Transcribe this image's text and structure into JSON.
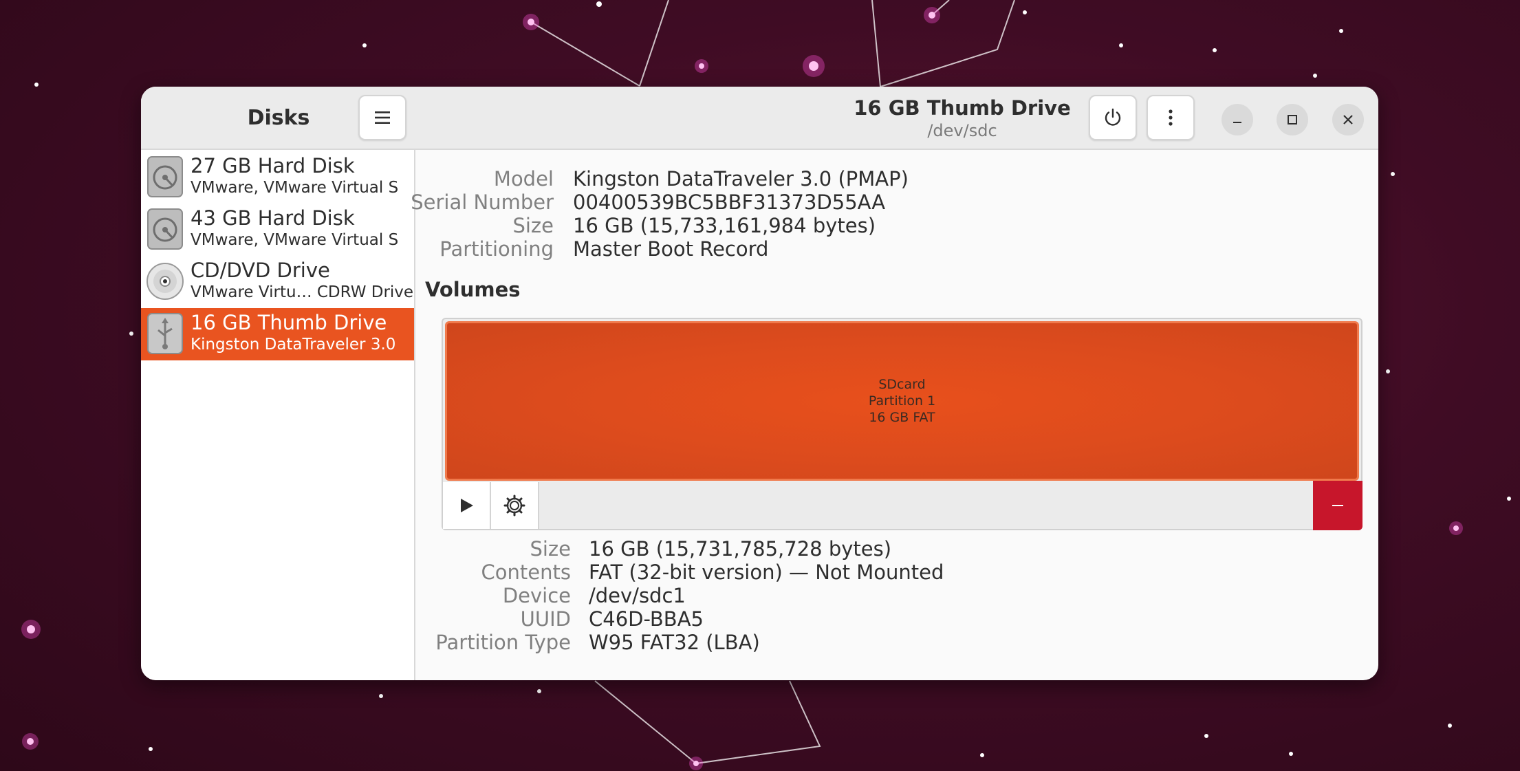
{
  "sidebar": {
    "title": "Disks",
    "menu_icon": "hamburger-menu-icon",
    "disks": [
      {
        "name": "27 GB Hard Disk",
        "subtitle": "VMware, VMware Virtual S",
        "icon": "hard-disk-icon"
      },
      {
        "name": "43 GB Hard Disk",
        "subtitle": "VMware, VMware Virtual S",
        "icon": "hard-disk-icon"
      },
      {
        "name": "CD/DVD Drive",
        "subtitle": "VMware Virtu… CDRW Drive",
        "icon": "optical-disc-icon"
      },
      {
        "name": "16 GB Thumb Drive",
        "subtitle": "Kingston DataTraveler 3.0",
        "icon": "usb-drive-icon",
        "selected": true
      }
    ]
  },
  "header": {
    "title": "16 GB Thumb Drive",
    "subtitle": "/dev/sdc"
  },
  "drive_info": {
    "model_label": "Model",
    "model": "Kingston DataTraveler 3.0 (PMAP)",
    "serial_label": "Serial Number",
    "serial": "00400539BC5BBF31373D55AA",
    "size_label": "Size",
    "size": "16 GB (15,733,161,984 bytes)",
    "partitioning_label": "Partitioning",
    "partitioning": "Master Boot Record"
  },
  "volumes": {
    "title": "Volumes",
    "partition": {
      "label": "SDcard",
      "name": "Partition 1",
      "summary": "16 GB FAT"
    },
    "details": {
      "size_label": "Size",
      "size": "16 GB (15,731,785,728 bytes)",
      "contents_label": "Contents",
      "contents": "FAT (32-bit version) — Not Mounted",
      "device_label": "Device",
      "device": "/dev/sdc1",
      "uuid_label": "UUID",
      "uuid": "C46D-BBA5",
      "partition_type_label": "Partition Type",
      "partition_type": "W95 FAT32 (LBA)"
    }
  },
  "colors": {
    "accent": "#e95420",
    "delete": "#c7162b"
  }
}
